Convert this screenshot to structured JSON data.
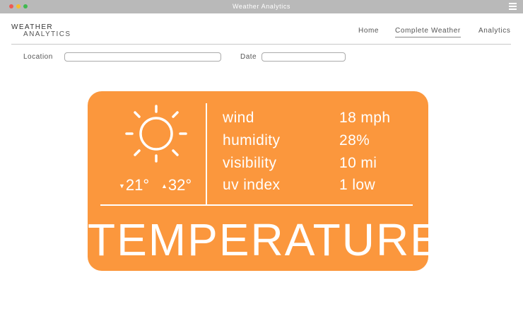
{
  "window": {
    "title": "Weather Analytics"
  },
  "brand": {
    "line1": "WEATHER",
    "line2": "ANALYTICS"
  },
  "nav": {
    "items": [
      {
        "label": "Home"
      },
      {
        "label": "Complete Weather",
        "active": true
      },
      {
        "label": "Analytics"
      }
    ]
  },
  "filters": {
    "location_label": "Location",
    "location_value": "",
    "date_label": "Date",
    "date_value": ""
  },
  "weather": {
    "icon": "sun-icon",
    "low_temp": "21°",
    "high_temp": "32°",
    "metrics": [
      {
        "label": "wind",
        "value": "18 mph"
      },
      {
        "label": "humidity",
        "value": "28%"
      },
      {
        "label": "visibility",
        "value": "10 mi"
      },
      {
        "label": "uv index",
        "value": "1 low"
      }
    ],
    "title": "TEMPERATURE"
  },
  "colors": {
    "card": "#fb973d",
    "titlebar": "#b9b9b9"
  }
}
